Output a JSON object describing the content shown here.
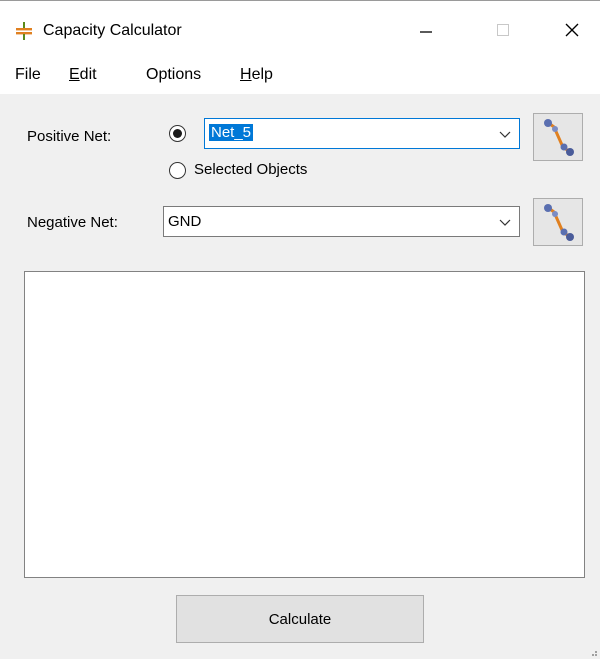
{
  "window": {
    "title": "Capacity Calculator"
  },
  "menu": {
    "items": [
      "File",
      "Edit",
      "Options",
      "Help"
    ]
  },
  "form": {
    "positive_label": "Positive Net:",
    "positive_value": "Net_5",
    "selected_objects_label": "Selected Objects",
    "negative_label": "Negative Net:",
    "negative_value": "GND"
  },
  "actions": {
    "calculate_label": "Calculate"
  },
  "colors": {
    "accent": "#0078d7",
    "icon_orange": "#e08020",
    "icon_blue": "#5a6fb0"
  },
  "icons": [
    "capacitor-icon",
    "minimize-icon",
    "maximize-icon",
    "close-icon",
    "chevron-down-icon",
    "net-picker-icon",
    "resize-grip-icon"
  ]
}
